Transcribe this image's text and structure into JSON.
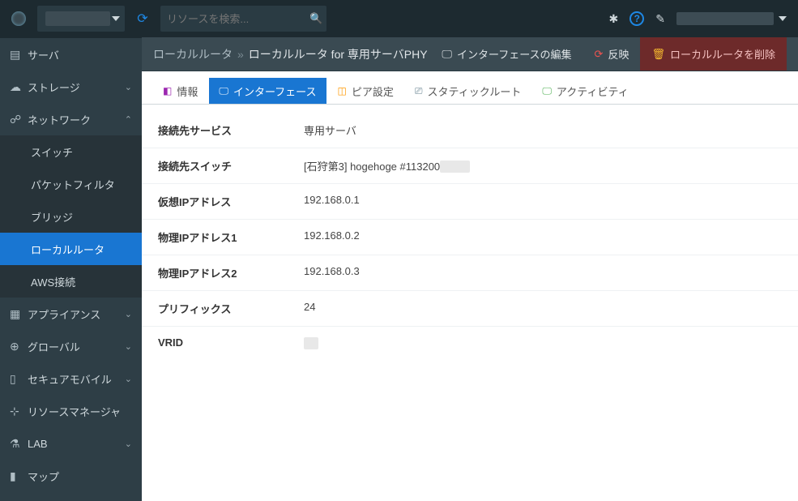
{
  "topbar": {
    "search_placeholder": "リソースを検索..."
  },
  "sidebar": {
    "server": "サーバ",
    "storage": "ストレージ",
    "network": "ネットワーク",
    "network_children": {
      "switch": "スイッチ",
      "packet_filter": "パケットフィルタ",
      "bridge": "ブリッジ",
      "local_router": "ローカルルータ",
      "aws": "AWS接続"
    },
    "appliance": "アプライアンス",
    "global": "グローバル",
    "secure_mobile": "セキュアモバイル",
    "resource_manager": "リソースマネージャ",
    "lab": "LAB",
    "map": "マップ"
  },
  "breadcrumb": {
    "root": "ローカルルータ",
    "current": "ローカルルータ for 専用サーバPHY"
  },
  "actions": {
    "edit_interface": "インターフェースの編集",
    "reload": "反映",
    "delete": "ローカルルータを削除"
  },
  "tabs": {
    "info": "情報",
    "interface": "インターフェース",
    "peer": "ピア設定",
    "static_route": "スタティックルート",
    "activity": "アクティビティ"
  },
  "details": [
    {
      "label": "接続先サービス",
      "value": "専用サーバ"
    },
    {
      "label": "接続先スイッチ",
      "value": "[石狩第3] hogehoge #113200"
    },
    {
      "label": "仮想IPアドレス",
      "value": "192.168.0.1"
    },
    {
      "label": "物理IPアドレス1",
      "value": "192.168.0.2"
    },
    {
      "label": "物理IPアドレス2",
      "value": "192.168.0.3"
    },
    {
      "label": "プリフィックス",
      "value": "24"
    },
    {
      "label": "VRID",
      "value": ""
    }
  ]
}
